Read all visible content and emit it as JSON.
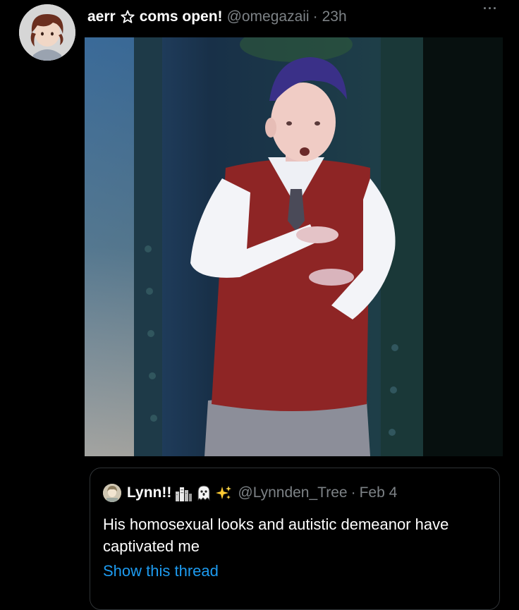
{
  "tweet": {
    "display_name": "aerr",
    "name_suffix": "coms open!",
    "star_icon": "star-outline-icon",
    "handle": "@omegazaii",
    "separator": "·",
    "time": "23h",
    "more_label": "···"
  },
  "quoted_tweet": {
    "display_name": "Lynn!!",
    "emoji_icons": [
      "buildings-icon",
      "ghost-icon",
      "sparkles-icon"
    ],
    "handle": "@Lynnden_Tree",
    "separator": "·",
    "date": "Feb 4",
    "text": "His homosexual looks and autistic demeanor have captivated me",
    "show_thread_label": "Show this thread"
  },
  "colors": {
    "background": "#000000",
    "text_primary": "#ffffff",
    "text_secondary": "#7d8286",
    "link": "#1d9bf0",
    "border": "#2f3336"
  }
}
